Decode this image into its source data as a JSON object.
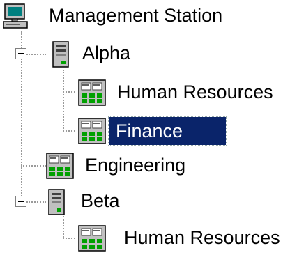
{
  "tree": {
    "root": {
      "label": "Management Station",
      "icon": "computer-icon",
      "expanded": true,
      "children": [
        {
          "label": "Alpha",
          "icon": "server-icon",
          "expanded": true,
          "children": [
            {
              "label": "Human Resources",
              "icon": "domain-icon",
              "selected": false
            },
            {
              "label": "Finance",
              "icon": "domain-icon",
              "selected": true
            }
          ]
        },
        {
          "label": "Engineering",
          "icon": "domain-icon",
          "selected": false
        },
        {
          "label": "Beta",
          "icon": "server-icon",
          "expanded": true,
          "children": [
            {
              "label": "Human Resources",
              "icon": "domain-icon",
              "selected": false
            }
          ]
        }
      ]
    }
  },
  "colors": {
    "selection_background": "#0a246a",
    "selection_text": "#ffffff",
    "connector_lines": "#9a9a9a"
  }
}
